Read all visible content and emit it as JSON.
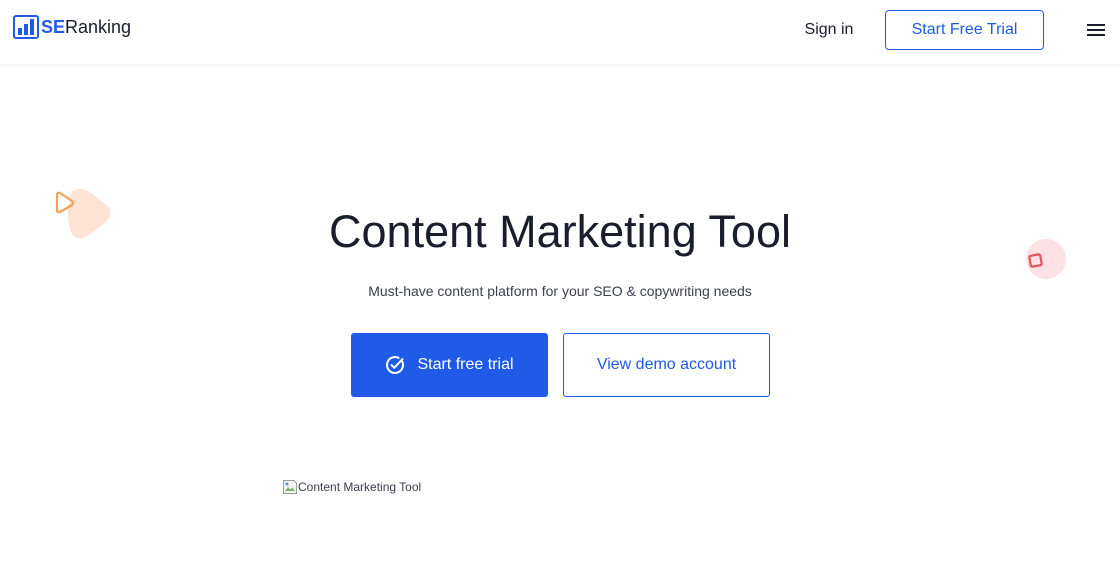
{
  "colors": {
    "brand_blue": "#1f5be6",
    "text_dark": "#1a1d2b",
    "deco_orange": "#f5a05a",
    "deco_red": "#e8505b"
  },
  "header": {
    "logo": {
      "se": "SE",
      "ranking": "Ranking",
      "icon": "bar-chart-logo-icon"
    },
    "sign_in": "Sign in",
    "start_trial": "Start Free Trial",
    "menu_icon": "hamburger-menu-icon"
  },
  "hero": {
    "title": "Content Marketing Tool",
    "subtitle": "Must-have content platform for your SEO & copywriting needs",
    "primary_button": {
      "label": "Start free trial",
      "icon": "check-circle-icon"
    },
    "secondary_button": {
      "label": "View demo account"
    },
    "decorations": [
      "play-triangle-icon",
      "square-icon"
    ]
  },
  "image": {
    "alt": "Content Marketing Tool",
    "icon": "broken-image-icon"
  }
}
